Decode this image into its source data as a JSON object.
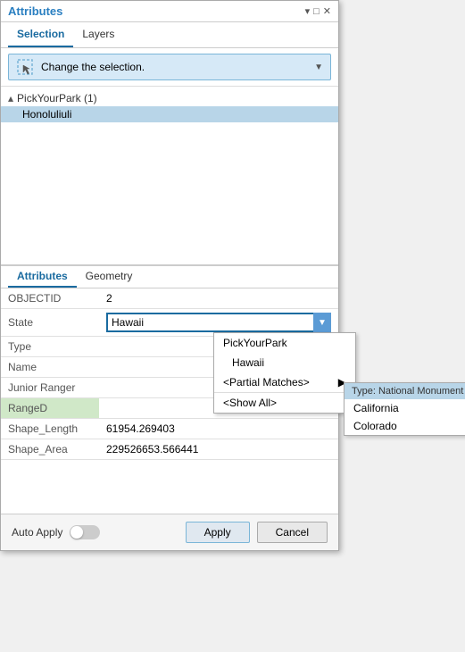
{
  "titleBar": {
    "title": "Attributes",
    "controls": [
      "▾",
      "□",
      "✕"
    ]
  },
  "tabs": [
    {
      "label": "Selection",
      "active": true
    },
    {
      "label": "Layers",
      "active": false
    }
  ],
  "selectionDropdown": {
    "label": "Change the selection.",
    "icon": "selection-cursor-icon"
  },
  "listArea": {
    "groups": [
      {
        "header": "PickYourPark (1)",
        "items": [
          {
            "label": "Honoluliuli",
            "selected": true
          }
        ]
      }
    ]
  },
  "attributeSection": {
    "tabs": [
      {
        "label": "Attributes",
        "active": true
      },
      {
        "label": "Geometry",
        "active": false
      }
    ],
    "rows": [
      {
        "field": "OBJECTID",
        "value": "2"
      },
      {
        "field": "State",
        "value": "Hawaii",
        "editable": true,
        "dropdown": true
      },
      {
        "field": "Type",
        "value": ""
      },
      {
        "field": "Name",
        "value": ""
      },
      {
        "field": "Junior Ranger",
        "value": ""
      },
      {
        "field": "RangeD",
        "value": "",
        "highlight": true
      },
      {
        "field": "Shape_Length",
        "value": "61954.269403"
      },
      {
        "field": "Shape_Area",
        "value": "229526653.566441"
      }
    ]
  },
  "stateDropdownMenu": {
    "items": [
      {
        "label": "PickYourPark",
        "indented": false
      },
      {
        "label": "Hawaii",
        "indented": true
      },
      {
        "label": "<Partial Matches>",
        "indented": false,
        "hasSubmenu": true
      },
      {
        "label": "<Show All>",
        "indented": false
      }
    ]
  },
  "partialMatchesSubmenu": {
    "header": "Type: National Monument",
    "items": [
      {
        "label": "California"
      },
      {
        "label": "Colorado"
      }
    ]
  },
  "footer": {
    "autoApplyLabel": "Auto Apply",
    "applyLabel": "Apply",
    "cancelLabel": "Cancel"
  }
}
